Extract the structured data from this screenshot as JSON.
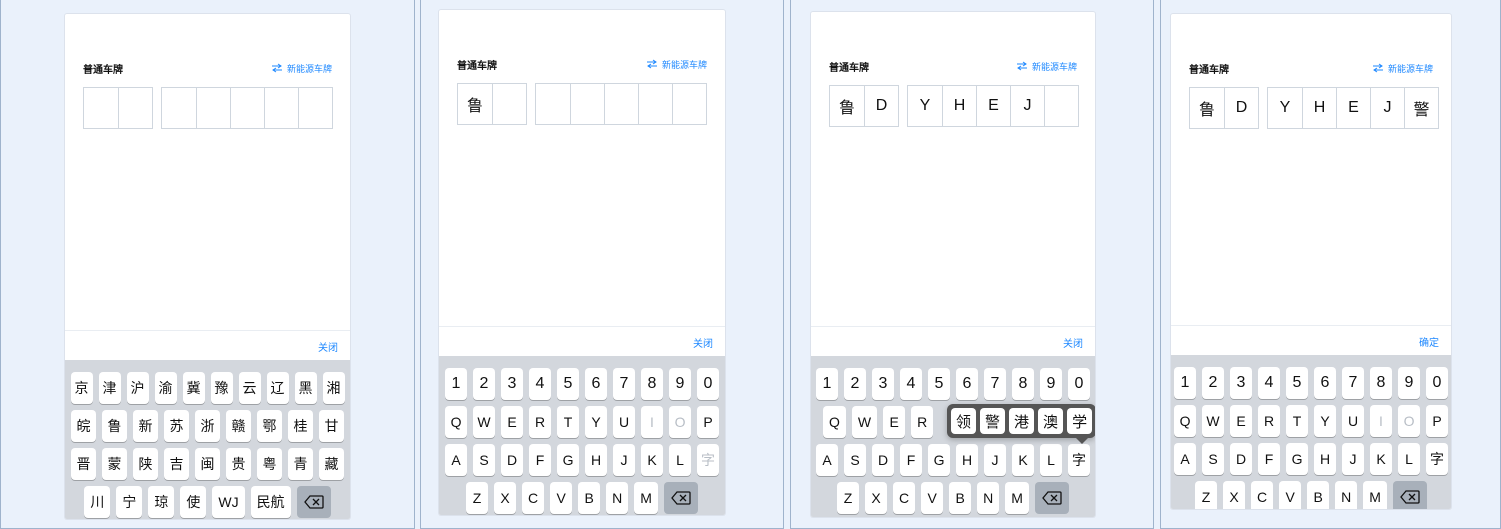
{
  "frames": [
    {
      "title": "普通车牌",
      "switch_label": "新能源车牌",
      "close_label": "关闭",
      "plate_first": [
        "",
        ""
      ],
      "plate_rest": [
        "",
        "",
        "",
        "",
        ""
      ],
      "keyboard": {
        "row1": [
          "京",
          "津",
          "沪",
          "渝",
          "冀",
          "豫",
          "云",
          "辽",
          "黑",
          "湘"
        ],
        "row2": [
          "皖",
          "鲁",
          "新",
          "苏",
          "浙",
          "赣",
          "鄂",
          "桂",
          "甘"
        ],
        "row3": [
          "晋",
          "蒙",
          "陕",
          "吉",
          "闽",
          "贵",
          "粤",
          "青",
          "藏"
        ],
        "row4": [
          "川",
          "宁",
          "琼",
          "使",
          "WJ",
          "民航"
        ]
      }
    },
    {
      "title": "普通车牌",
      "switch_label": "新能源车牌",
      "close_label": "关闭",
      "plate_first": [
        "鲁",
        ""
      ],
      "plate_rest": [
        "",
        "",
        "",
        "",
        ""
      ],
      "keyboard": {
        "row1": [
          "1",
          "2",
          "3",
          "4",
          "5",
          "6",
          "7",
          "8",
          "9",
          "0"
        ],
        "row2": [
          "Q",
          "W",
          "E",
          "R",
          "T",
          "Y",
          "U",
          "I",
          "O",
          "P"
        ],
        "row3": [
          "A",
          "S",
          "D",
          "F",
          "G",
          "H",
          "J",
          "K",
          "L",
          "字"
        ],
        "row4": [
          "Z",
          "X",
          "C",
          "V",
          "B",
          "N",
          "M"
        ]
      }
    },
    {
      "title": "普通车牌",
      "switch_label": "新能源车牌",
      "close_label": "关闭",
      "plate_first": [
        "鲁",
        "D"
      ],
      "plate_rest": [
        "Y",
        "H",
        "E",
        "J",
        ""
      ],
      "popover": [
        "领",
        "警",
        "港",
        "澳",
        "学"
      ],
      "keyboard": {
        "row1": [
          "1",
          "2",
          "3",
          "4",
          "5",
          "6",
          "7",
          "8",
          "9",
          "0"
        ],
        "row2": [
          "Q",
          "W",
          "E",
          "R"
        ],
        "row3": [
          "A",
          "S",
          "D",
          "F",
          "G",
          "H",
          "J",
          "K",
          "L",
          "字"
        ],
        "row4": [
          "Z",
          "X",
          "C",
          "V",
          "B",
          "N",
          "M"
        ]
      }
    },
    {
      "title": "普通车牌",
      "switch_label": "新能源车牌",
      "close_label": "确定",
      "plate_first": [
        "鲁",
        "D"
      ],
      "plate_rest": [
        "Y",
        "H",
        "E",
        "J",
        "警"
      ],
      "keyboard": {
        "row1": [
          "1",
          "2",
          "3",
          "4",
          "5",
          "6",
          "7",
          "8",
          "9",
          "0"
        ],
        "row2": [
          "Q",
          "W",
          "E",
          "R",
          "T",
          "Y",
          "U",
          "I",
          "O",
          "P"
        ],
        "row3": [
          "A",
          "S",
          "D",
          "F",
          "G",
          "H",
          "J",
          "K",
          "L",
          "字"
        ],
        "row4": [
          "Z",
          "X",
          "C",
          "V",
          "B",
          "N",
          "M"
        ]
      }
    }
  ]
}
